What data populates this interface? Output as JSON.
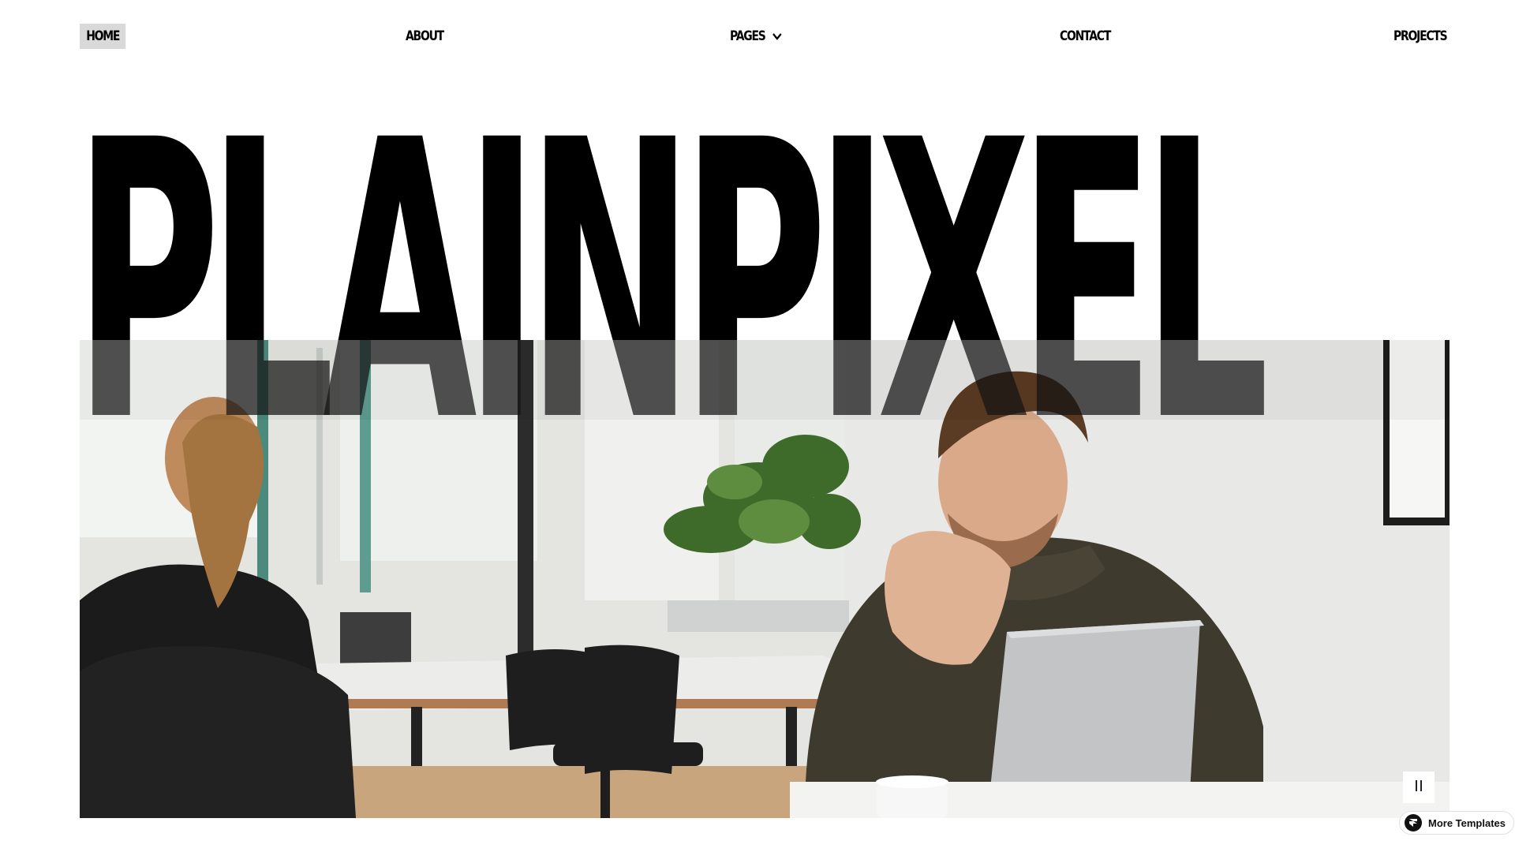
{
  "nav": {
    "items": [
      {
        "label": "HOME",
        "active": true
      },
      {
        "label": "ABOUT"
      },
      {
        "label": "PAGES",
        "has_dropdown": true
      },
      {
        "label": "CONTACT"
      },
      {
        "label": "PROJECTS"
      }
    ]
  },
  "hero": {
    "wordmark": "PLAINPIXEL"
  },
  "media": {
    "controls": {
      "pause_icon": "pause-icon"
    }
  },
  "badge": {
    "label": "More Templates",
    "icon": "framer-logo-icon"
  },
  "colors": {
    "background": "#ffffff",
    "text": "#000000",
    "active_nav_bg": "#d9d9d9"
  }
}
